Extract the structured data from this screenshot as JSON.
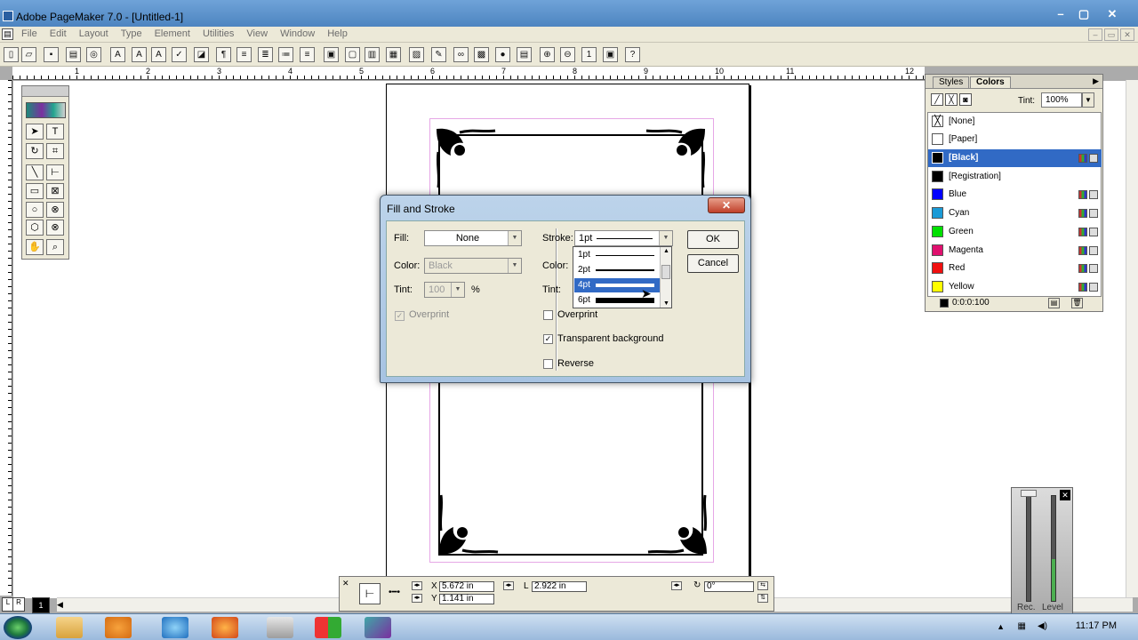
{
  "window": {
    "title": "Adobe PageMaker 7.0 - [Untitled-1]",
    "min": "–",
    "max": "▢",
    "close": "✕"
  },
  "menu": [
    "File",
    "Edit",
    "Layout",
    "Type",
    "Element",
    "Utilities",
    "View",
    "Window",
    "Help"
  ],
  "ruler": {
    "h": [
      "1",
      "2",
      "3",
      "4",
      "5",
      "6",
      "7",
      "8",
      "9",
      "10",
      "11",
      "12"
    ]
  },
  "colors_panel": {
    "tabs": [
      "Styles",
      "Colors"
    ],
    "tint_label": "Tint:",
    "tint_value": "100%",
    "items": [
      {
        "name": "[None]",
        "color": "none"
      },
      {
        "name": "[Paper]",
        "color": "#ffffff"
      },
      {
        "name": "[Black]",
        "color": "#000000",
        "selected": true
      },
      {
        "name": "[Registration]",
        "color": "#000000"
      },
      {
        "name": "Blue",
        "color": "#0000ff"
      },
      {
        "name": "Cyan",
        "color": "#1a9ad6"
      },
      {
        "name": "Green",
        "color": "#00e000"
      },
      {
        "name": "Magenta",
        "color": "#e0106e"
      },
      {
        "name": "Red",
        "color": "#f01010"
      },
      {
        "name": "Yellow",
        "color": "#ffff00"
      }
    ],
    "footer_value": "0:0:0:100"
  },
  "dialog": {
    "title": "Fill and Stroke",
    "close": "✕",
    "fill_label": "Fill:",
    "fill_value": "None",
    "fill_color_label": "Color:",
    "fill_color_value": "Black",
    "fill_tint_label": "Tint:",
    "fill_tint_value": "100",
    "fill_tint_unit": "%",
    "fill_overprint_label": "Overprint",
    "stroke_label": "Stroke:",
    "stroke_value": "1pt",
    "stroke_color_label": "Color:",
    "stroke_tint_label": "Tint:",
    "stroke_overprint_label": "Overprint",
    "transparent_label": "Transparent background",
    "reverse_label": "Reverse",
    "ok_label": "OK",
    "cancel_label": "Cancel",
    "stroke_options": [
      "1pt",
      "2pt",
      "4pt",
      "6pt"
    ]
  },
  "control_palette": {
    "x": "5.672 in",
    "y": "1.141 in",
    "l_label": "L",
    "length": "2.922 in",
    "angle": "0°",
    "x_label": "X",
    "y_label": "Y"
  },
  "volume": {
    "rec": "Rec.",
    "level": "Level"
  },
  "taskbar": {
    "time": "11:17 PM"
  }
}
